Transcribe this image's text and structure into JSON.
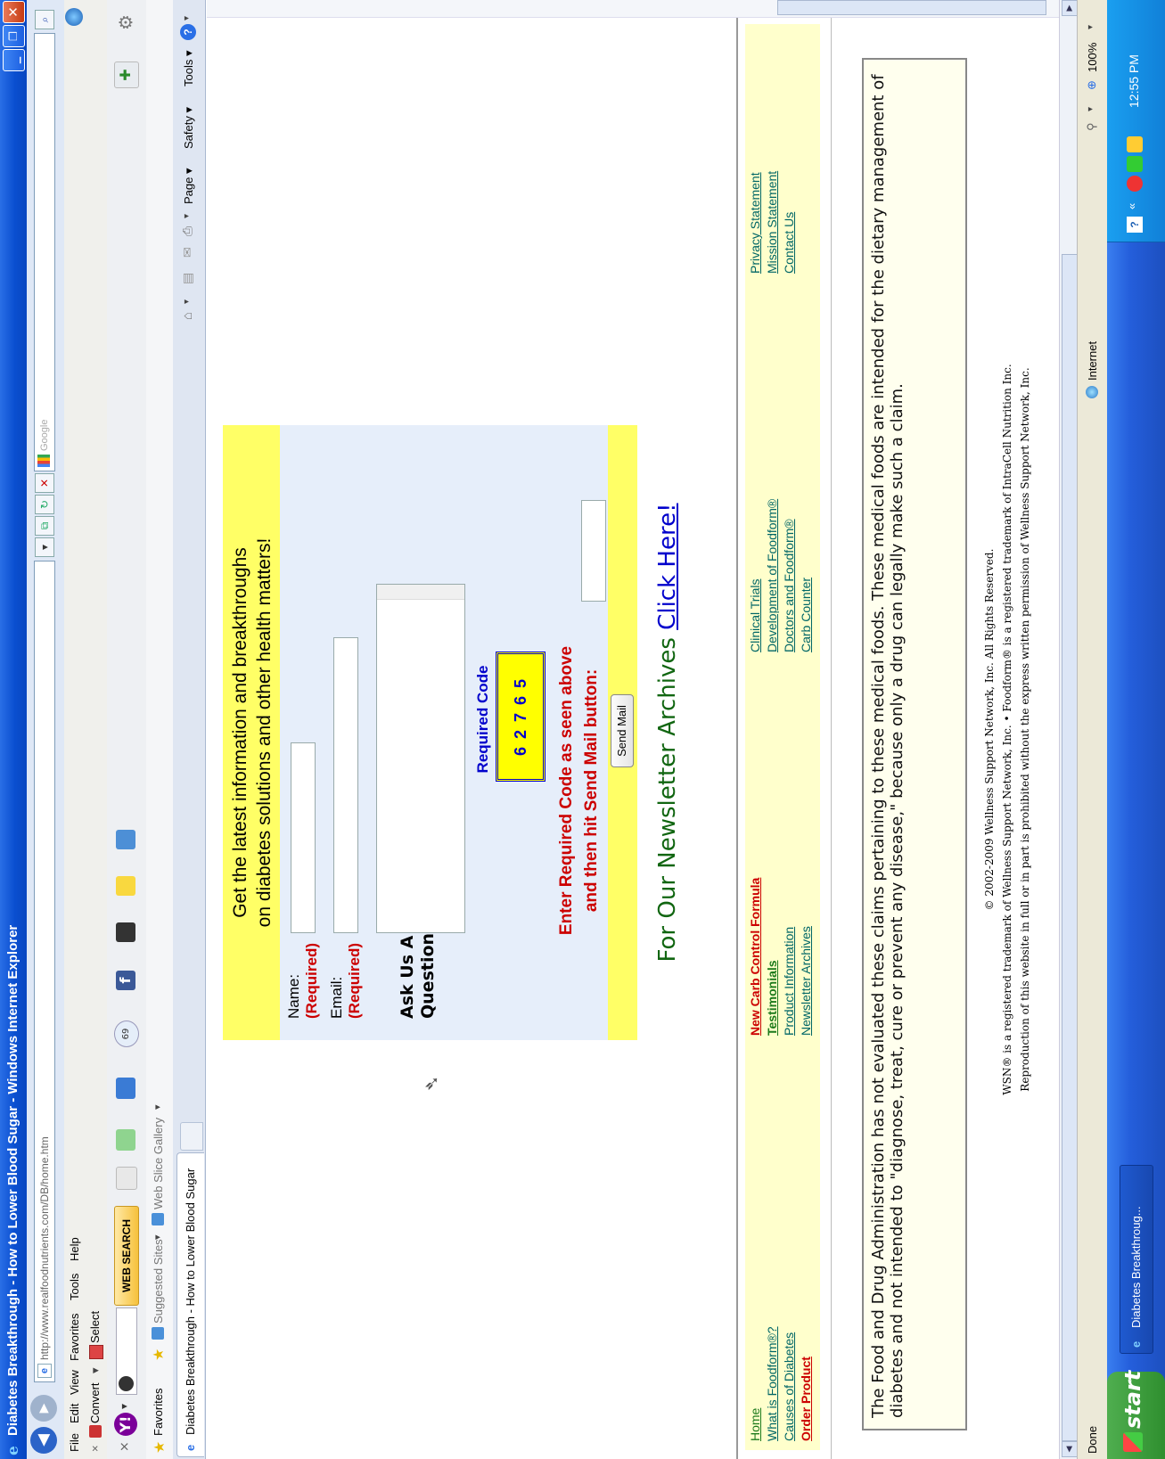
{
  "window": {
    "title": "Diabetes Breakthrough - How to Lower Blood Sugar - Windows Internet Explorer",
    "minimize": "_",
    "restore": "❐",
    "close": "✕"
  },
  "address": {
    "url": "http://www.realfoodnutrients.com/DB/home.htm",
    "search_placeholder": "Google"
  },
  "menu": [
    "File",
    "Edit",
    "View",
    "Favorites",
    "Tools",
    "Help"
  ],
  "convert_bar": {
    "close": "×",
    "convert": "Convert",
    "select": "Select"
  },
  "yahoo_bar": {
    "close": "×",
    "web_search": "WEB SEARCH",
    "badge": "69"
  },
  "favorites_bar": {
    "favorites": "Favorites",
    "suggested_sites": "Suggested Sites",
    "web_slice_gallery": "Web Slice Gallery"
  },
  "tab": {
    "label": "Diabetes Breakthrough - How to Lower Blood Sugar"
  },
  "command_bar": {
    "page": "Page",
    "safety": "Safety",
    "tools": "Tools"
  },
  "form": {
    "heading_line1": "Get the latest information and breakthroughs",
    "heading_line2": "on diabetes solutions and other health matters!",
    "name_label": "Name:",
    "email_label": "Email:",
    "required": "(Required)",
    "ask_line1": "Ask Us A",
    "ask_line2": "Question!",
    "required_code_label": "Required Code",
    "code": "6 2 7 6 5",
    "instruction_line1": "Enter Required Code as seen above",
    "instruction_line2": "and then hit Send Mail button:",
    "send_button": "Send Mail"
  },
  "newsletter": {
    "text": "For Our Newsletter Archives",
    "link": "Click Here!"
  },
  "footer": {
    "col1": [
      {
        "label": "Home",
        "style": "green"
      },
      {
        "label": "What is Foodform®?",
        "style": "teal"
      },
      {
        "label": "Causes of Diabetes",
        "style": "teal"
      },
      {
        "label": "Order Product",
        "style": "red"
      }
    ],
    "col2": [
      {
        "label": "New Carb Control Formula",
        "style": "red"
      },
      {
        "label": "Testimonials",
        "style": "greenbold"
      },
      {
        "label": "Product Information",
        "style": "teal"
      },
      {
        "label": "Newsletter Archives",
        "style": "teal"
      }
    ],
    "col3": [
      {
        "label": "Clinical Trials",
        "style": "teal"
      },
      {
        "label": "Development of Foodform®",
        "style": "teal"
      },
      {
        "label": "Doctors and Foodform®",
        "style": "teal"
      },
      {
        "label": "Carb Counter",
        "style": "teal"
      }
    ],
    "col4": [
      {
        "label": "Privacy Statement",
        "style": "teal"
      },
      {
        "label": "Mission Statement",
        "style": "teal"
      },
      {
        "label": "Contact Us",
        "style": "teal"
      }
    ]
  },
  "disclaimer": "The Food and Drug Administration has not evaluated these claims pertaining to these medical foods. These medical foods are intended for the dietary management of diabetes and not intended to \"diagnose, treat, cure or prevent any disease,\" because only a drug can legally make such a claim.",
  "copyright": [
    "© 2002-2009 Wellness Support Network, Inc. All Rights Reserved.",
    "WSN® is a registered trademark of Wellness Support Network, Inc. • Foodform® is a registered trademark of IntraCell Nutrition Inc.",
    "Reproduction of this website in full or in part is prohibited without the express written permission of Wellness Support Network, Inc."
  ],
  "status_bar": {
    "left": "Done",
    "zone": "Internet",
    "zoom": "100%"
  },
  "taskbar": {
    "start": "start",
    "task": "Diabetes Breakthroug...",
    "clock": "12:55 PM"
  },
  "colors": {
    "form_yellow": "#ffff66",
    "form_blue": "#e6eefa",
    "code_box": "#ffff00",
    "title_blue": "#0a4fd0"
  }
}
